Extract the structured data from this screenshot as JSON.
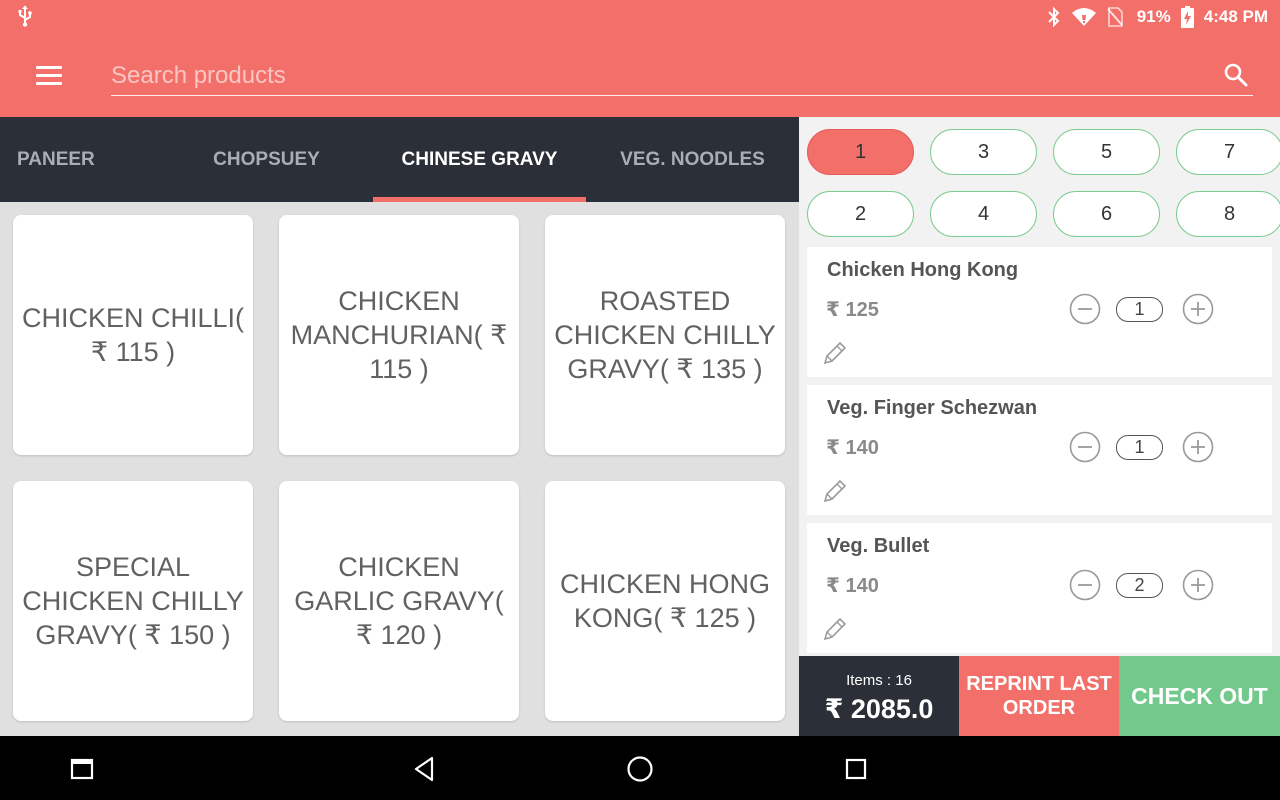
{
  "status_bar": {
    "battery": "91%",
    "time": "4:48 PM"
  },
  "search": {
    "placeholder": "Search products"
  },
  "tabs": [
    {
      "label": "PANEER"
    },
    {
      "label": "CHOPSUEY"
    },
    {
      "label": "CHINESE GRAVY",
      "active": true
    },
    {
      "label": "VEG. NOODLES"
    }
  ],
  "products": [
    {
      "label": "CHICKEN CHILLI( ₹ 115 )"
    },
    {
      "label": "CHICKEN MANCHURIAN( ₹ 115 )"
    },
    {
      "label": "ROASTED CHICKEN CHILLY GRAVY( ₹ 135 )"
    },
    {
      "label": "SPECIAL CHICKEN CHILLY GRAVY( ₹ 150 )"
    },
    {
      "label": "CHICKEN GARLIC GRAVY( ₹ 120 )"
    },
    {
      "label": "CHICKEN HONG KONG( ₹ 125 )"
    }
  ],
  "tables": [
    "1",
    "3",
    "5",
    "7",
    "2",
    "4",
    "6",
    "8"
  ],
  "selected_table": "1",
  "cart": [
    {
      "name": "Chicken Hong Kong",
      "price": "₹ 125",
      "qty": "1"
    },
    {
      "name": "Veg. Finger Schezwan",
      "price": "₹ 140",
      "qty": "1"
    },
    {
      "name": "Veg. Bullet",
      "price": "₹ 140",
      "qty": "2"
    }
  ],
  "summary": {
    "items": "Items : 16",
    "total": "₹ 2085.0"
  },
  "actions": {
    "reprint": "REPRINT LAST ORDER",
    "checkout": "CHECK OUT"
  },
  "colors": {
    "accent": "#f3706a",
    "dark": "#2a2f38",
    "checkout": "#72c98b"
  }
}
